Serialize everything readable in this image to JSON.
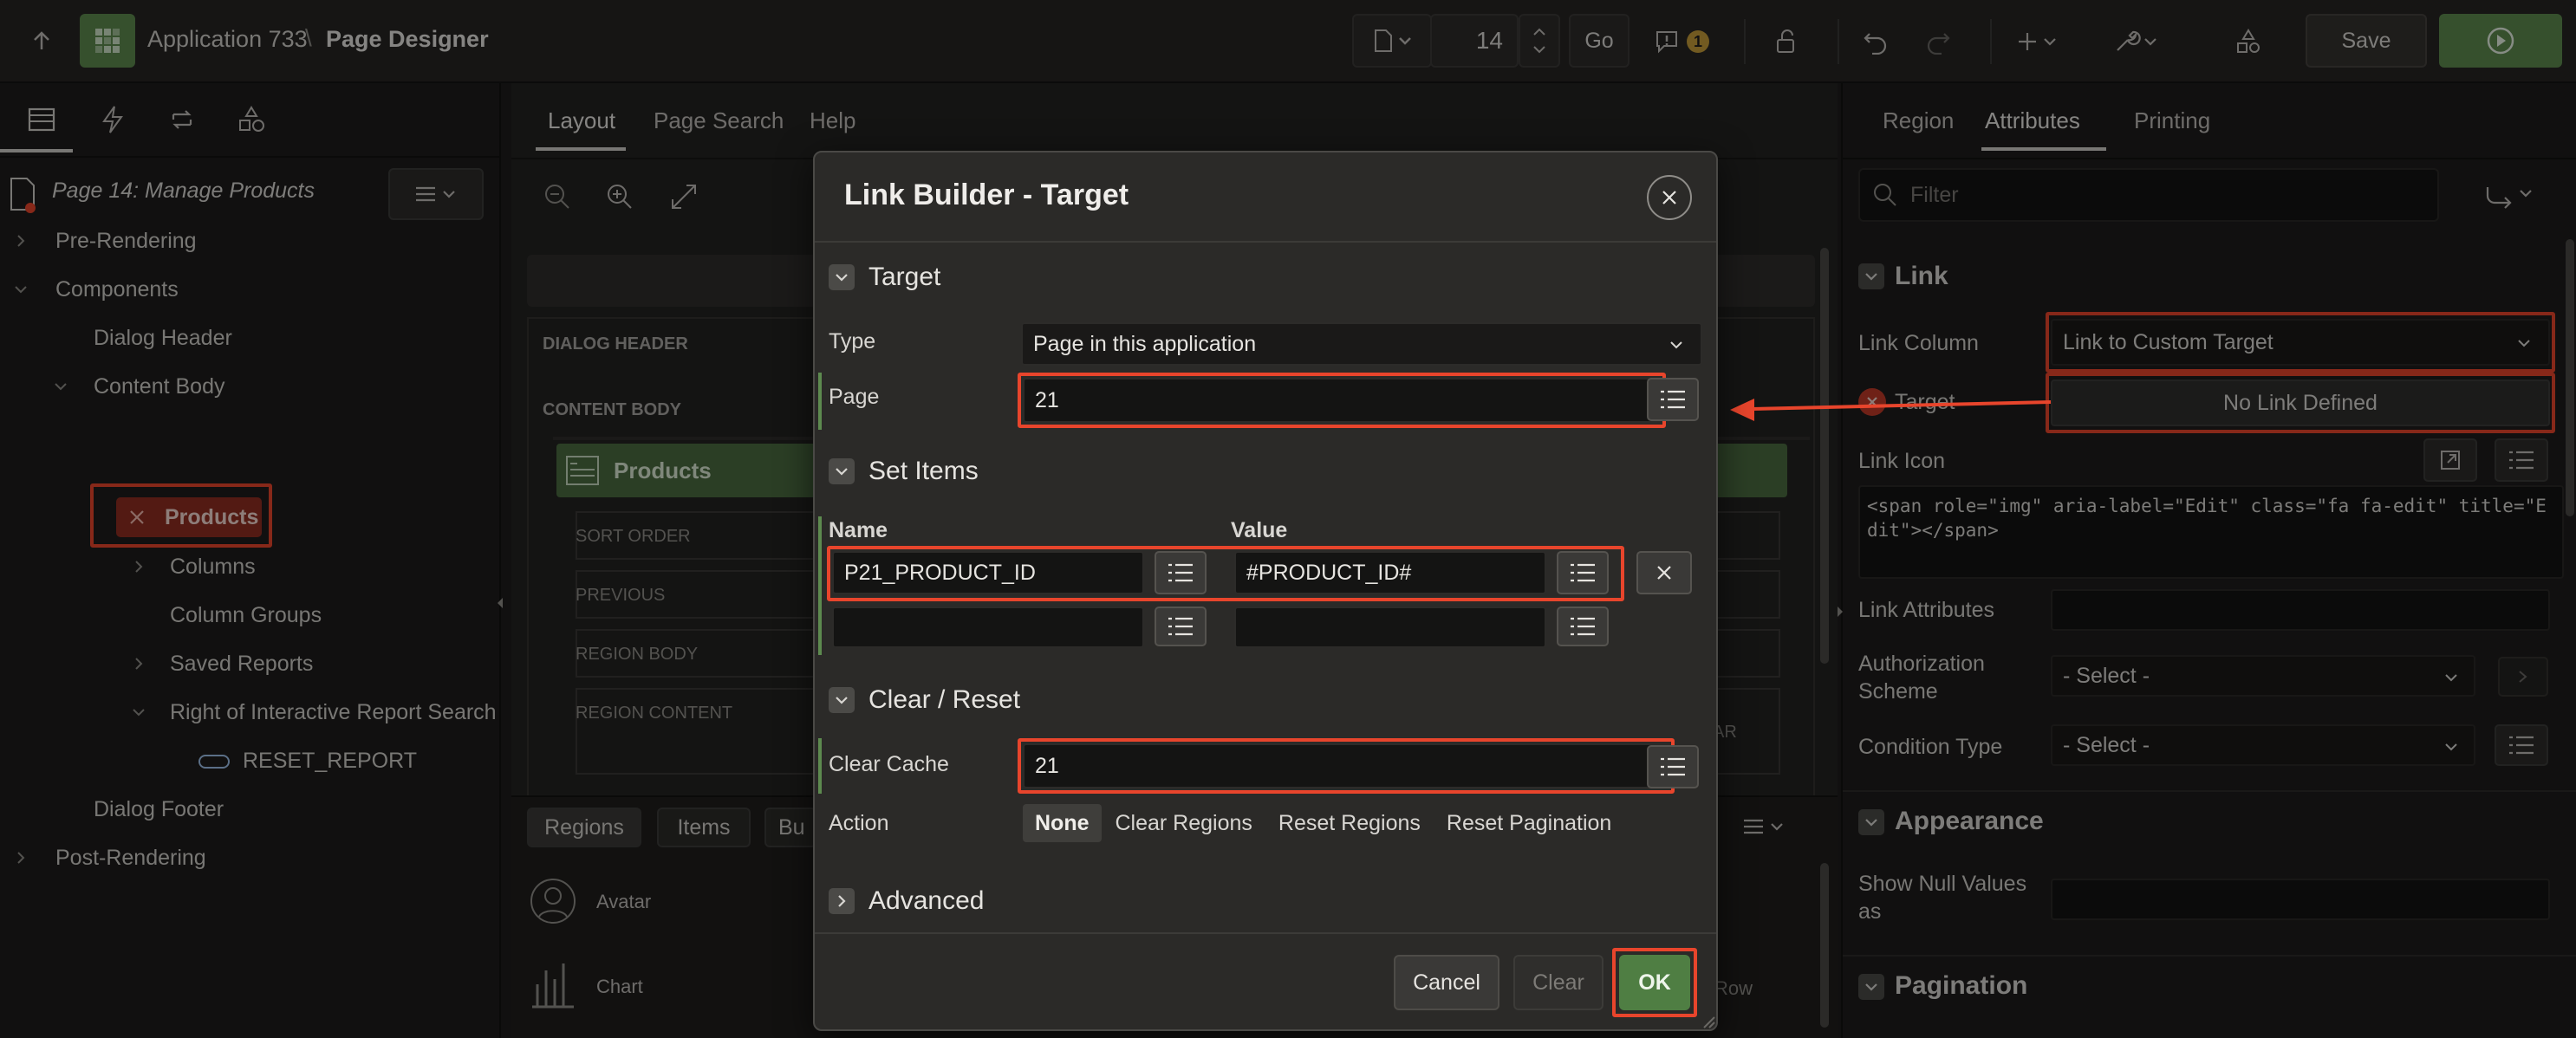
{
  "topbar": {
    "app_name": "Application 733",
    "breadcrumb_sep": "\\",
    "page_designer": "Page Designer",
    "page_number": "14",
    "go_label": "Go",
    "notification_count": "1",
    "save_label": "Save",
    "accent": "#5d8a4f"
  },
  "left_panel": {
    "page_title": "Page 14: Manage Products",
    "tree": {
      "pre_rendering": "Pre-Rendering",
      "components": "Components",
      "dialog_header": "Dialog Header",
      "content_body": "Content Body",
      "products": "Products",
      "columns": "Columns",
      "column_groups": "Column Groups",
      "saved_reports": "Saved Reports",
      "right_of_search": "Right of Interactive Report Search B",
      "reset_report": "RESET_REPORT",
      "dialog_footer": "Dialog Footer",
      "post_rendering": "Post-Rendering"
    }
  },
  "center_panel": {
    "tabs": [
      "Layout",
      "Page Search",
      "Help"
    ],
    "dialog_header": "DIALOG HEADER",
    "content_body": "CONTENT BODY",
    "region_title": "Products",
    "slots": [
      "SORT ORDER",
      "PREVIOUS",
      "REGION BODY",
      "REGION CONTENT"
    ],
    "right_clip_ar": "AR",
    "right_clip_row": "Row",
    "gallery_tabs": [
      "Regions",
      "Items",
      "Bu"
    ],
    "gallery_items": [
      "Avatar",
      "Chart"
    ]
  },
  "right_panel": {
    "tabs": [
      "Region",
      "Attributes",
      "Printing"
    ],
    "filter_placeholder": "Filter",
    "link_section": "Link",
    "link_column_label": "Link Column",
    "link_column_value": "Link to Custom Target",
    "target_label": "Target",
    "target_value": "No Link Defined",
    "link_icon_label": "Link Icon",
    "link_icon_value": "<span role=\"img\" aria-label=\"Edit\" class=\"fa fa-edit\" title=\"Edit\"></span>",
    "link_attributes_label": "Link Attributes",
    "authorization_label_1": "Authorization",
    "authorization_label_2": "Scheme",
    "authorization_value": "- Select -",
    "condition_label": "Condition Type",
    "condition_value": "- Select -",
    "appearance_section": "Appearance",
    "show_null_label_1": "Show Null Values",
    "show_null_label_2": "as",
    "pagination_section": "Pagination"
  },
  "dialog": {
    "title": "Link Builder - Target",
    "target_section": "Target",
    "type_label": "Type",
    "type_value": "Page in this application",
    "page_label": "Page",
    "page_value": "21",
    "set_items_section": "Set Items",
    "name_header": "Name",
    "value_header": "Value",
    "item_name_1": "P21_PRODUCT_ID",
    "item_value_1": "#PRODUCT_ID#",
    "clear_reset_section": "Clear / Reset",
    "clear_cache_label": "Clear Cache",
    "clear_cache_value": "21",
    "action_label": "Action",
    "action_options": [
      "None",
      "Clear Regions",
      "Reset Regions",
      "Reset Pagination"
    ],
    "advanced_section": "Advanced",
    "cancel_label": "Cancel",
    "clear_label": "Clear",
    "ok_label": "OK",
    "highlight_color": "#e8452c"
  }
}
